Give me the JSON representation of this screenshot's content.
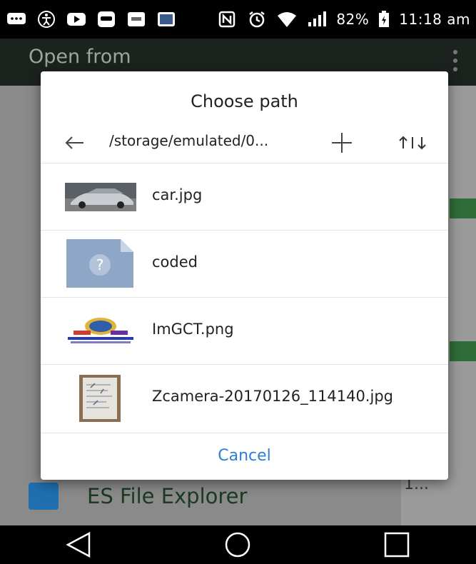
{
  "status_bar": {
    "icons": [
      "message-icon",
      "accessibility-icon",
      "youtube-icon",
      "app-icon",
      "bible-icon",
      "bible-app-icon",
      "nfc-icon",
      "alarm-icon",
      "wifi-icon",
      "signal-icon"
    ],
    "battery": "82%",
    "time": "11:18 am"
  },
  "background_app": {
    "title": "Open from",
    "row_label": "ES File Explorer",
    "ellipsis": "1..."
  },
  "dialog": {
    "title": "Choose path",
    "path": "/storage/emulated/0...",
    "files": [
      {
        "name": "car.jpg",
        "icon": "car-photo-thumbnail"
      },
      {
        "name": "coded",
        "icon": "unknown-file-icon"
      },
      {
        "name": "ImGCT.png",
        "icon": "crystal-logo-thumbnail"
      },
      {
        "name": "Zcamera-20170126_114140.jpg",
        "icon": "paper-photo-thumbnail"
      }
    ],
    "cancel_label": "Cancel"
  },
  "colors": {
    "accent": "#2d7fd3",
    "file_icon_bg": "#8fa7c7"
  }
}
